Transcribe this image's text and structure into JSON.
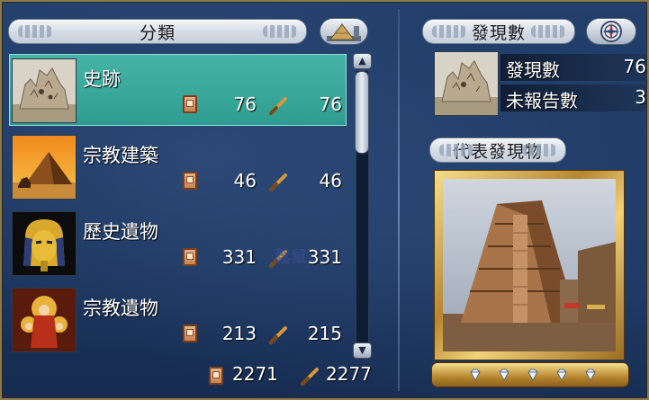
{
  "left_panel": {
    "header": "分類",
    "categories": [
      {
        "name": "史跡",
        "found": "76",
        "total": "76",
        "selected": true
      },
      {
        "name": "宗教建築",
        "found": "46",
        "total": "46",
        "selected": false
      },
      {
        "name": "歷史遺物",
        "found": "331",
        "total": "331",
        "selected": false
      },
      {
        "name": "宗教遺物",
        "found": "213",
        "total": "215",
        "selected": false
      }
    ],
    "totals": {
      "found": "2271",
      "total": "2277"
    },
    "scroll": {
      "up": "▲",
      "down": "▼"
    }
  },
  "right_panel": {
    "header": "發現數",
    "stats": [
      {
        "label": "發現數",
        "value": "76"
      },
      {
        "label": "未報告數",
        "value": "3"
      }
    ],
    "representative_header": "代表發現物",
    "gem_count": 5
  },
  "watermark": "鬆鼠",
  "colors": {
    "selected_row": "#3aa89b",
    "header_bg": "#dfe4ec",
    "panel_bg": "#1b3661",
    "gold_frame": "#c99b3d"
  },
  "icons": {
    "book": "book-icon",
    "telescope": "telescope-icon",
    "pyramid": "pyramid-icon",
    "compass": "compass-icon",
    "gem": "diamond-icon"
  }
}
